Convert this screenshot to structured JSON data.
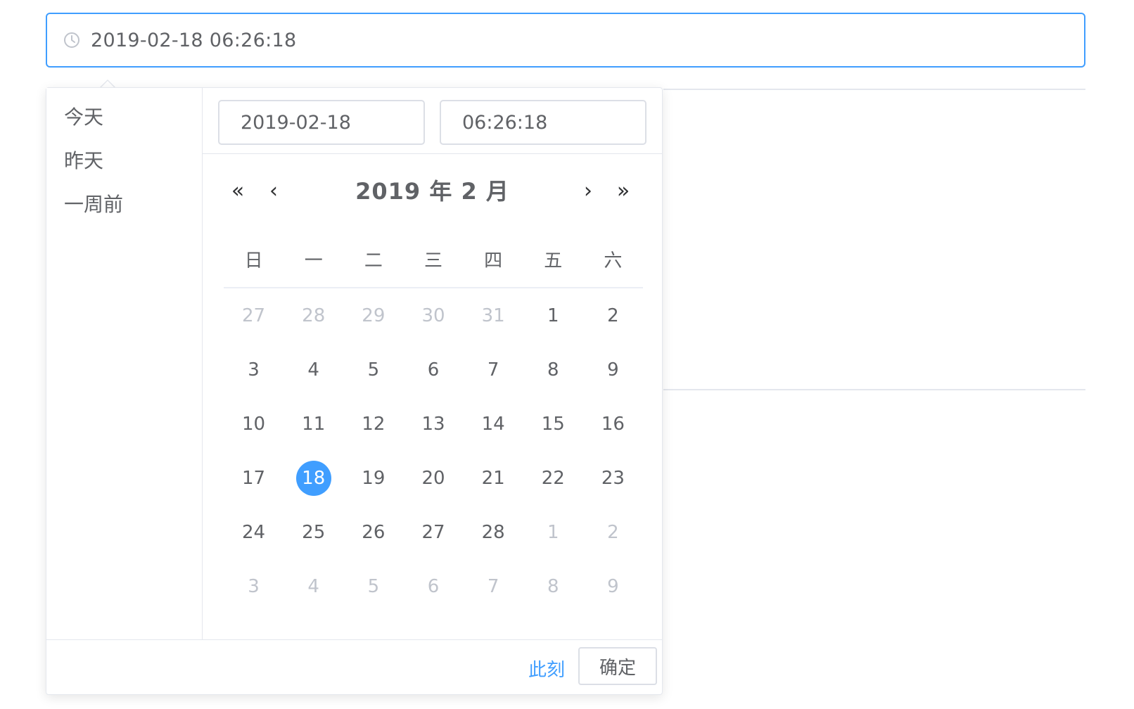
{
  "datetime_input": {
    "value": "2019-02-18 06:26:18",
    "icon": "clock-icon"
  },
  "sidebar": {
    "shortcuts": [
      {
        "label": "今天"
      },
      {
        "label": "昨天"
      },
      {
        "label": "一周前"
      }
    ]
  },
  "picker": {
    "date_value": "2019-02-18",
    "time_value": "06:26:18",
    "nav": {
      "prev_year": "«",
      "prev_month": "‹",
      "next_month": "›",
      "next_year": "»"
    },
    "header_label": "2019 年  2 月",
    "weekdays": [
      "日",
      "一",
      "二",
      "三",
      "四",
      "五",
      "六"
    ],
    "days": [
      {
        "label": "27",
        "muted": true
      },
      {
        "label": "28",
        "muted": true
      },
      {
        "label": "29",
        "muted": true
      },
      {
        "label": "30",
        "muted": true
      },
      {
        "label": "31",
        "muted": true
      },
      {
        "label": "1",
        "muted": false
      },
      {
        "label": "2",
        "muted": false
      },
      {
        "label": "3",
        "muted": false
      },
      {
        "label": "4",
        "muted": false
      },
      {
        "label": "5",
        "muted": false
      },
      {
        "label": "6",
        "muted": false
      },
      {
        "label": "7",
        "muted": false
      },
      {
        "label": "8",
        "muted": false
      },
      {
        "label": "9",
        "muted": false
      },
      {
        "label": "10",
        "muted": false
      },
      {
        "label": "11",
        "muted": false
      },
      {
        "label": "12",
        "muted": false
      },
      {
        "label": "13",
        "muted": false
      },
      {
        "label": "14",
        "muted": false
      },
      {
        "label": "15",
        "muted": false
      },
      {
        "label": "16",
        "muted": false
      },
      {
        "label": "17",
        "muted": false
      },
      {
        "label": "18",
        "muted": false,
        "selected": true
      },
      {
        "label": "19",
        "muted": false
      },
      {
        "label": "20",
        "muted": false
      },
      {
        "label": "21",
        "muted": false
      },
      {
        "label": "22",
        "muted": false
      },
      {
        "label": "23",
        "muted": false
      },
      {
        "label": "24",
        "muted": false
      },
      {
        "label": "25",
        "muted": false
      },
      {
        "label": "26",
        "muted": false
      },
      {
        "label": "27",
        "muted": false
      },
      {
        "label": "28",
        "muted": false
      },
      {
        "label": "1",
        "muted": true
      },
      {
        "label": "2",
        "muted": true
      },
      {
        "label": "3",
        "muted": true
      },
      {
        "label": "4",
        "muted": true
      },
      {
        "label": "5",
        "muted": true
      },
      {
        "label": "6",
        "muted": true
      },
      {
        "label": "7",
        "muted": true
      },
      {
        "label": "8",
        "muted": true
      },
      {
        "label": "9",
        "muted": true
      }
    ],
    "footer": {
      "now_label": "此刻",
      "confirm_label": "确定"
    }
  },
  "colors": {
    "accent": "#409eff",
    "text": "#606266",
    "muted": "#c0c4cc",
    "border": "#dcdfe6"
  }
}
